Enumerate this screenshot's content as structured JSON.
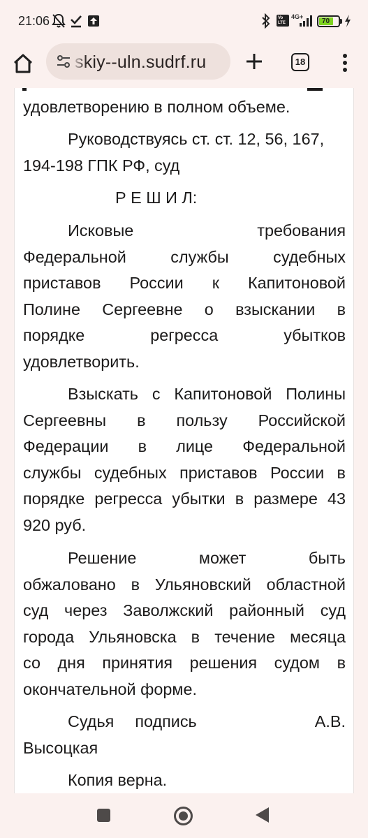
{
  "status_bar": {
    "time": "21:06",
    "icons": [
      "mute-bell-icon",
      "download-done-icon",
      "upload-icon",
      "bluetooth-icon",
      "volte-icon",
      "signal-icon",
      "battery-icon",
      "charging-icon"
    ],
    "network_label": "4G+",
    "volte_label": "Vo LTE",
    "battery_level": "70"
  },
  "toolbar": {
    "url": "skiy--uln.sudrf.ru",
    "tab_count": "18"
  },
  "document": {
    "line_1": "удовлетворению в полном объеме.",
    "para_1_line_1": "Руководствуясь ст. ст. 12, 56, 167,",
    "para_1_line_2": "194-198 ГПК РФ, суд",
    "heading": "Р Е Ш И Л:",
    "para_2": [
      "Исковые требования",
      "Федеральной службы судебных",
      "приставов России к Капитоновой",
      "Полине Сергеевне о взыскании в",
      "порядке регресса убытков"
    ],
    "para_2_last": "удовлетворить.",
    "para_3": [
      "Взыскать с Капитоновой Полины",
      "Сергеевны в пользу Российской",
      "Федерации в лице Федеральной",
      "службы судебных приставов России в",
      "порядке регресса убытки в размере 43"
    ],
    "para_3_last": "920 руб.",
    "para_4": [
      "Решение может быть",
      "обжаловано в Ульяновский областной",
      "суд через Заволжский районный суд",
      "города Ульяновска в течение месяца",
      "со дня принятия решения судом в"
    ],
    "para_4_last": "окончательной форме.",
    "signature_judge": "Судья",
    "signature_sign": "подпись",
    "signature_initials": "А.В.",
    "signature_name": "Высоцкая",
    "copy_note": "Копия верна."
  }
}
